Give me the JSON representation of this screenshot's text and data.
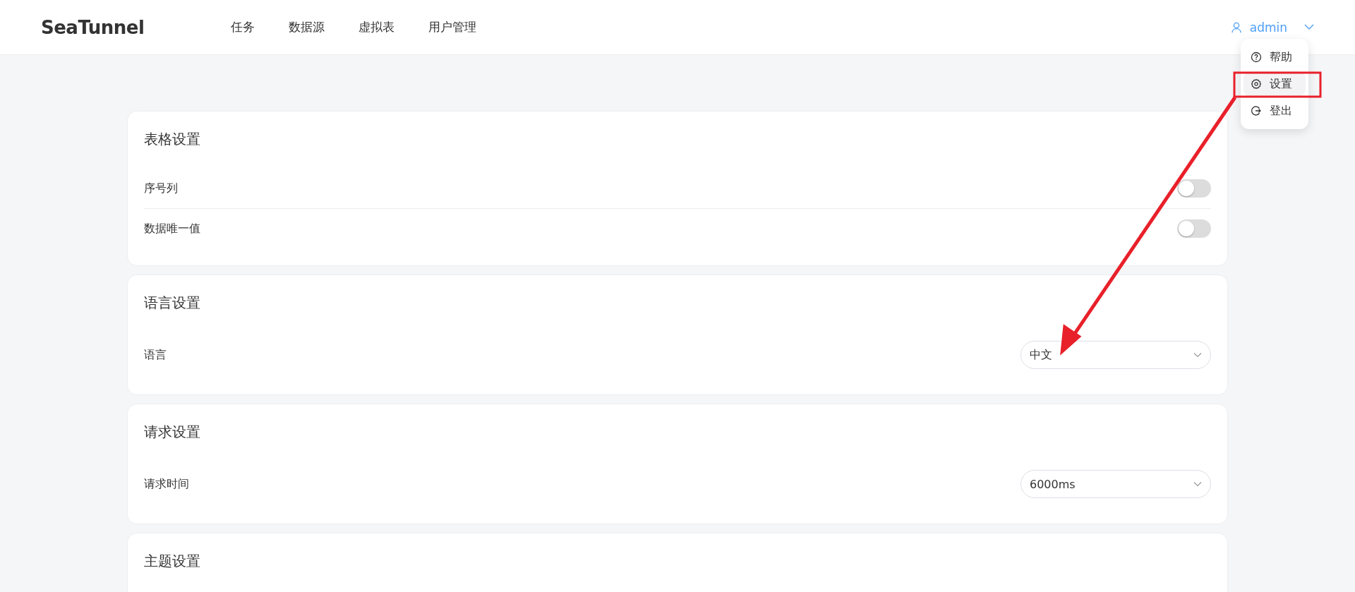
{
  "header": {
    "logo": "SeaTunnel",
    "nav": [
      {
        "label": "任务",
        "selected": false
      },
      {
        "label": "数据源",
        "selected": false
      },
      {
        "label": "虚拟表",
        "selected": false
      },
      {
        "label": "用户管理",
        "selected": false
      }
    ],
    "user": {
      "name": "admin"
    }
  },
  "user_menu": {
    "items": [
      {
        "label": "帮助",
        "kind": "help",
        "selected": false
      },
      {
        "label": "设置",
        "kind": "settings",
        "selected": true
      },
      {
        "label": "登出",
        "kind": "logout",
        "selected": false
      }
    ]
  },
  "cards": [
    {
      "title": "表格设置",
      "rows": [
        {
          "kind": "switch",
          "label": "序号列",
          "on": false
        },
        {
          "kind": "switch",
          "label": "数据唯一值",
          "on": false
        }
      ]
    },
    {
      "title": "语言设置",
      "rows": [
        {
          "kind": "select",
          "label": "语言",
          "value": "中文"
        }
      ]
    },
    {
      "title": "请求设置",
      "rows": [
        {
          "kind": "select",
          "label": "请求时间",
          "value": "6000ms"
        }
      ]
    },
    {
      "title": "主题设置"
    }
  ]
}
